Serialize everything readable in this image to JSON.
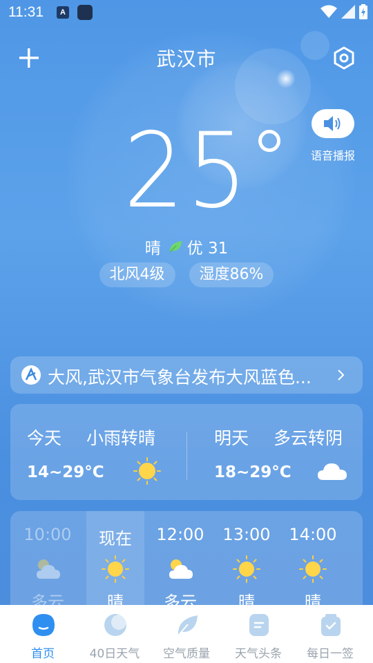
{
  "status": {
    "time": "11:31",
    "notif_badge": "A"
  },
  "header": {
    "city": "武汉市"
  },
  "voice": {
    "label": "语音播报"
  },
  "current": {
    "temperature": "25",
    "condition": "晴",
    "aqi_label": "优 31",
    "wind": "北风4级",
    "humidity": "湿度86%"
  },
  "alert": {
    "text": "大风,武汉市气象台发布大风蓝色..."
  },
  "forecast": [
    {
      "day": "今天",
      "condition": "小雨转晴",
      "temp": "14~29°C",
      "icon": "sun-icon"
    },
    {
      "day": "明天",
      "condition": "多云转阴",
      "temp": "18~29°C",
      "icon": "cloud-icon"
    }
  ],
  "hourly": [
    {
      "time": "10:00",
      "condition": "多云",
      "icon": "partly-cloudy-icon",
      "past": true
    },
    {
      "time": "现在",
      "condition": "晴",
      "icon": "sun-icon",
      "current": true
    },
    {
      "time": "12:00",
      "condition": "多云",
      "icon": "partly-cloudy-icon"
    },
    {
      "time": "13:00",
      "condition": "晴",
      "icon": "sun-icon"
    },
    {
      "time": "14:00",
      "condition": "晴",
      "icon": "sun-icon"
    }
  ],
  "nav": [
    {
      "label": "首页",
      "icon": "home-icon",
      "active": true
    },
    {
      "label": "40日天气",
      "icon": "moon-icon"
    },
    {
      "label": "空气质量",
      "icon": "leaf-icon"
    },
    {
      "label": "天气头条",
      "icon": "news-icon"
    },
    {
      "label": "每日一签",
      "icon": "bag-icon"
    }
  ],
  "colors": {
    "accent": "#2f8ff0",
    "leaf": "#6fd66f",
    "sun": "#ffd54a",
    "nav_inactive": "#b9d4ee"
  }
}
